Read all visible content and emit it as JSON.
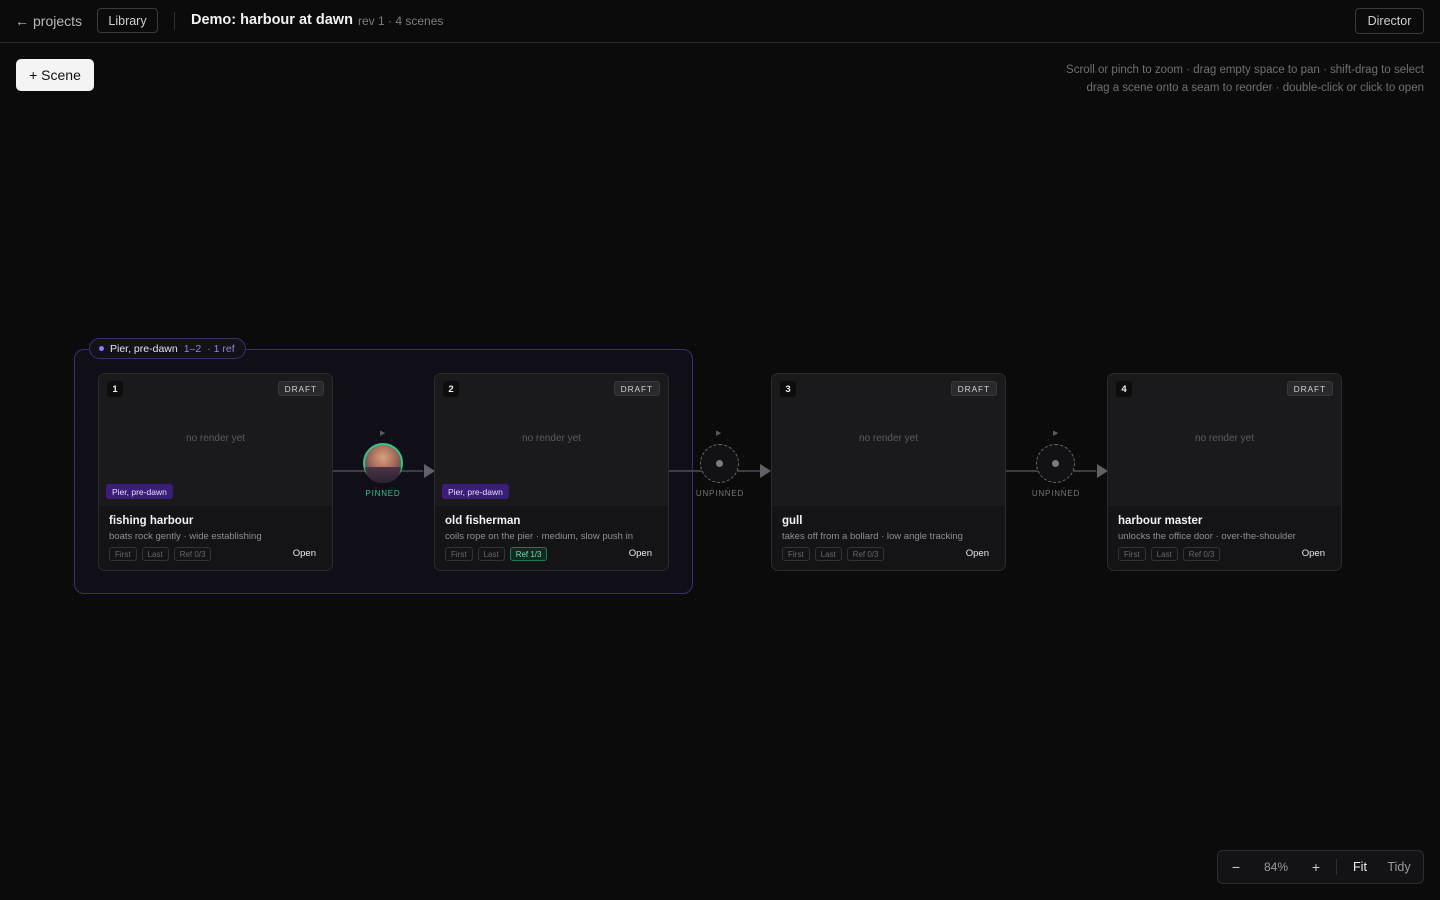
{
  "topbar": {
    "back_label": "projects",
    "library_label": "Library",
    "title": "Demo: harbour at dawn",
    "meta": "rev 1 · 4 scenes",
    "director_label": "Director"
  },
  "toolbar": {
    "add_scene_label": "+ Scene",
    "hint_line1": "Scroll or pinch to zoom · drag empty space to pan · shift-drag to select",
    "hint_line2": "drag a scene onto a seam to reorder · double-click or click to open"
  },
  "group": {
    "name": "Pier, pre-dawn",
    "range": "1–2",
    "refs": "· 1 ref",
    "accent": "#8b7bff"
  },
  "scenes": [
    {
      "number": "1",
      "status": "DRAFT",
      "placeholder": "no render yet",
      "tag": "Pier, pre-dawn",
      "title": "fishing harbour",
      "subtitle": "boats rock gently · wide establishing",
      "chip_first": "First",
      "chip_last": "Last",
      "chip_ref": "Ref 0/3",
      "open_label": "Open"
    },
    {
      "number": "2",
      "status": "DRAFT",
      "placeholder": "no render yet",
      "tag": "Pier, pre-dawn",
      "title": "old fisherman",
      "subtitle": "coils rope on the pier · medium, slow push in",
      "chip_first": "First",
      "chip_last": "Last",
      "chip_ref": "Ref 1/3",
      "open_label": "Open"
    },
    {
      "number": "3",
      "status": "DRAFT",
      "placeholder": "no render yet",
      "tag": "",
      "title": "gull",
      "subtitle": "takes off from a bollard · low angle tracking",
      "chip_first": "First",
      "chip_last": "Last",
      "chip_ref": "Ref 0/3",
      "open_label": "Open"
    },
    {
      "number": "4",
      "status": "DRAFT",
      "placeholder": "no render yet",
      "tag": "",
      "title": "harbour master",
      "subtitle": "unlocks the office door · over-the-shoulder",
      "chip_first": "First",
      "chip_last": "Last",
      "chip_ref": "Ref 0/3",
      "open_label": "Open"
    }
  ],
  "transitions": [
    {
      "state": "PINNED",
      "play_icon": "play-icon"
    },
    {
      "state": "UNPINNED",
      "play_icon": "play-icon"
    },
    {
      "state": "UNPINNED",
      "play_icon": "play-icon"
    }
  ],
  "zoom": {
    "minus_label": "−",
    "level": "84%",
    "plus_label": "+",
    "fit_label": "Fit",
    "tidy_label": "Tidy"
  },
  "colors": {
    "pinned": "#2cc98a",
    "group_border": "#3b2f6e",
    "tag_bg": "#3a1f78"
  }
}
